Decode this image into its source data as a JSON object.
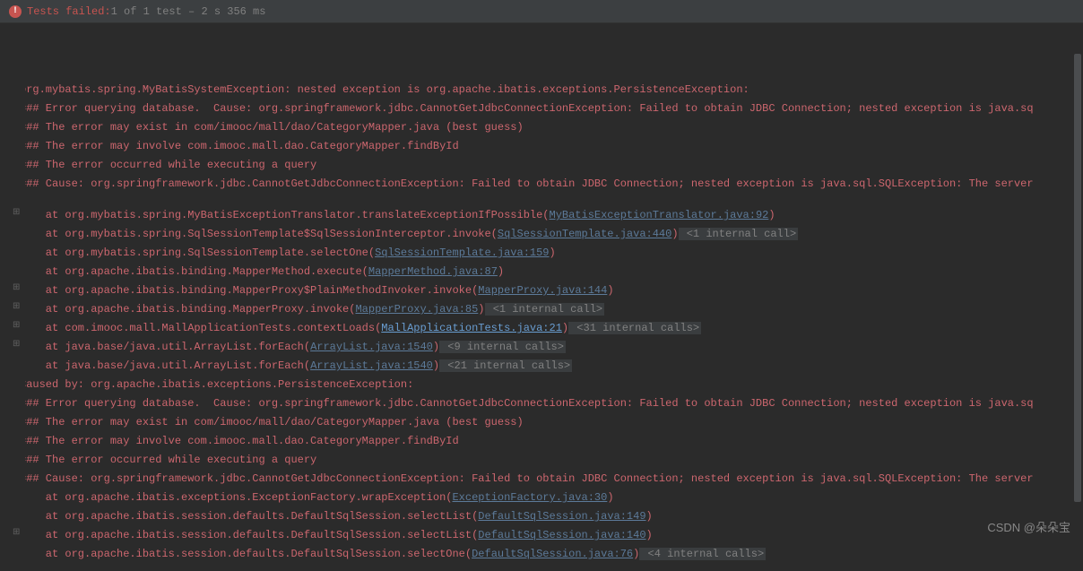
{
  "header": {
    "status_label": "Tests failed:",
    "status_detail": " 1 of 1 test – 2 s 356 ms"
  },
  "lines": [
    {
      "type": "blank"
    },
    {
      "type": "red",
      "text": "org.mybatis.spring.MyBatisSystemException: nested exception is org.apache.ibatis.exceptions.PersistenceException:"
    },
    {
      "type": "red",
      "text": "### Error querying database.  Cause: org.springframework.jdbc.CannotGetJdbcConnectionException: Failed to obtain JDBC Connection; nested exception is java.sq"
    },
    {
      "type": "red",
      "text": "### The error may exist in com/imooc/mall/dao/CategoryMapper.java (best guess)"
    },
    {
      "type": "red",
      "text": "### The error may involve com.imooc.mall.dao.CategoryMapper.findById"
    },
    {
      "type": "red",
      "text": "### The error occurred while executing a query"
    },
    {
      "type": "red",
      "text": "### Cause: org.springframework.jdbc.CannotGetJdbcConnectionException: Failed to obtain JDBC Connection; nested exception is java.sql.SQLException: The server"
    },
    {
      "type": "blank"
    },
    {
      "type": "trace",
      "pre": "    at org.mybatis.spring.MyBatisExceptionTranslator.translateExceptionIfPossible(",
      "link": "MyBatisExceptionTranslator.java:92",
      "post": ")"
    },
    {
      "type": "trace",
      "gutter": true,
      "pre": "    at org.mybatis.spring.SqlSessionTemplate$SqlSessionInterceptor.invoke(",
      "link": "SqlSessionTemplate.java:440",
      "post": ")",
      "extra": " <1 internal call>"
    },
    {
      "type": "trace",
      "pre": "    at org.mybatis.spring.SqlSessionTemplate.selectOne(",
      "link": "SqlSessionTemplate.java:159",
      "post": ")"
    },
    {
      "type": "trace",
      "pre": "    at org.apache.ibatis.binding.MapperMethod.execute(",
      "link": "MapperMethod.java:87",
      "post": ")"
    },
    {
      "type": "trace",
      "pre": "    at org.apache.ibatis.binding.MapperProxy$PlainMethodInvoker.invoke(",
      "link": "MapperProxy.java:144",
      "post": ")"
    },
    {
      "type": "trace",
      "gutter": true,
      "pre": "    at org.apache.ibatis.binding.MapperProxy.invoke(",
      "link": "MapperProxy.java:85",
      "post": ")",
      "extra": " <1 internal call>"
    },
    {
      "type": "trace",
      "gutter": true,
      "pre": "    at com.imooc.mall.MallApplicationTests.contextLoads(",
      "link_hi": "MallApplicationTests.java:21",
      "post": ")",
      "extra": " <31 internal calls>"
    },
    {
      "type": "trace",
      "gutter": true,
      "pre": "    at java.base/java.util.ArrayList.forEach(",
      "link": "ArrayList.java:1540",
      "post": ")",
      "extra": " <9 internal calls>"
    },
    {
      "type": "trace",
      "gutter": true,
      "pre": "    at java.base/java.util.ArrayList.forEach(",
      "link": "ArrayList.java:1540",
      "post": ")",
      "extra": " <21 internal calls>"
    },
    {
      "type": "red",
      "text": "Caused by: org.apache.ibatis.exceptions.PersistenceException:"
    },
    {
      "type": "red",
      "text": "### Error querying database.  Cause: org.springframework.jdbc.CannotGetJdbcConnectionException: Failed to obtain JDBC Connection; nested exception is java.sq"
    },
    {
      "type": "red",
      "text": "### The error may exist in com/imooc/mall/dao/CategoryMapper.java (best guess)"
    },
    {
      "type": "red",
      "text": "### The error may involve com.imooc.mall.dao.CategoryMapper.findById"
    },
    {
      "type": "red",
      "text": "### The error occurred while executing a query"
    },
    {
      "type": "red",
      "text": "### Cause: org.springframework.jdbc.CannotGetJdbcConnectionException: Failed to obtain JDBC Connection; nested exception is java.sql.SQLException: The server"
    },
    {
      "type": "trace",
      "pre": "    at org.apache.ibatis.exceptions.ExceptionFactory.wrapException(",
      "link": "ExceptionFactory.java:30",
      "post": ")"
    },
    {
      "type": "trace",
      "pre": "    at org.apache.ibatis.session.defaults.DefaultSqlSession.selectList(",
      "link": "DefaultSqlSession.java:149",
      "post": ")"
    },
    {
      "type": "trace",
      "pre": "    at org.apache.ibatis.session.defaults.DefaultSqlSession.selectList(",
      "link": "DefaultSqlSession.java:140",
      "post": ")"
    },
    {
      "type": "trace",
      "gutter": true,
      "pre": "    at org.apache.ibatis.session.defaults.DefaultSqlSession.selectOne(",
      "link": "DefaultSqlSession.java:76",
      "post": ")",
      "extra": " <4 internal calls>"
    }
  ],
  "watermark": "CSDN @朵朵宝"
}
